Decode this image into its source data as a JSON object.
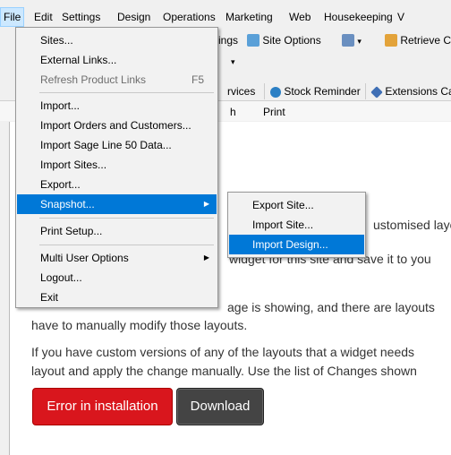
{
  "menubar": {
    "items": [
      "File",
      "Edit",
      "Settings",
      "Design",
      "Operations",
      "Marketing",
      "Web",
      "Housekeeping",
      "V"
    ]
  },
  "toolbar": {
    "items": [
      "ings",
      "Site Options",
      "Retrieve C"
    ]
  },
  "tabs": {
    "items": [
      "rvices",
      "Stock Reminder",
      "Extensions Ca"
    ]
  },
  "subbar": {
    "items": [
      "h",
      "Print"
    ]
  },
  "content": {
    "line1": "ustomised layo",
    "line2": "widget for this site and save it to you",
    "line3a": "age is showing, and there are layouts",
    "line3b": "have to manually modify those layouts.",
    "line4a": "If you have custom versions of any of the layouts that a widget needs",
    "line4b": "layout and apply the change manually. Use the list of Changes shown",
    "error_button": "Error in installation",
    "download_button": "Download"
  },
  "file_menu": {
    "items": [
      {
        "label": "Sites..."
      },
      {
        "label": "External Links..."
      },
      {
        "label": "Refresh Product Links",
        "shortcut": "F5"
      },
      {
        "label": "Import..."
      },
      {
        "label": "Import Orders and Customers..."
      },
      {
        "label": "Import Sage Line 50 Data..."
      },
      {
        "label": "Import Sites..."
      },
      {
        "label": "Export..."
      },
      {
        "label": "Snapshot..."
      },
      {
        "label": "Print Setup..."
      },
      {
        "label": "Multi User Options"
      },
      {
        "label": "Logout..."
      },
      {
        "label": "Exit"
      }
    ]
  },
  "snapshot_menu": {
    "items": [
      {
        "label": "Export Site..."
      },
      {
        "label": "Import Site..."
      },
      {
        "label": "Import Design..."
      }
    ]
  },
  "colors": {
    "highlight": "#0078d7",
    "error_button": "#d9161d",
    "download_button": "#444444"
  }
}
